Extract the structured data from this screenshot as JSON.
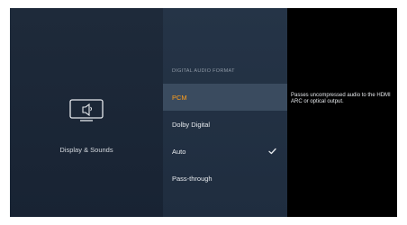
{
  "left": {
    "label": "Display & Sounds",
    "icon": "tv-speaker-icon"
  },
  "menu": {
    "heading": "DIGITAL AUDIO FORMAT",
    "items": [
      {
        "label": "PCM",
        "selected": true,
        "checked": false
      },
      {
        "label": "Dolby Digital",
        "selected": false,
        "checked": false
      },
      {
        "label": "Auto",
        "selected": false,
        "checked": true
      },
      {
        "label": "Pass-through",
        "selected": false,
        "checked": false
      }
    ]
  },
  "description": "Passes uncompressed audio to the HDMI ARC or optical output.",
  "colors": {
    "focus_text": "#ff9e1b",
    "focus_bg": "#3a4b5f",
    "left_bg": "#1e2a3a",
    "mid_bg": "#253447"
  }
}
